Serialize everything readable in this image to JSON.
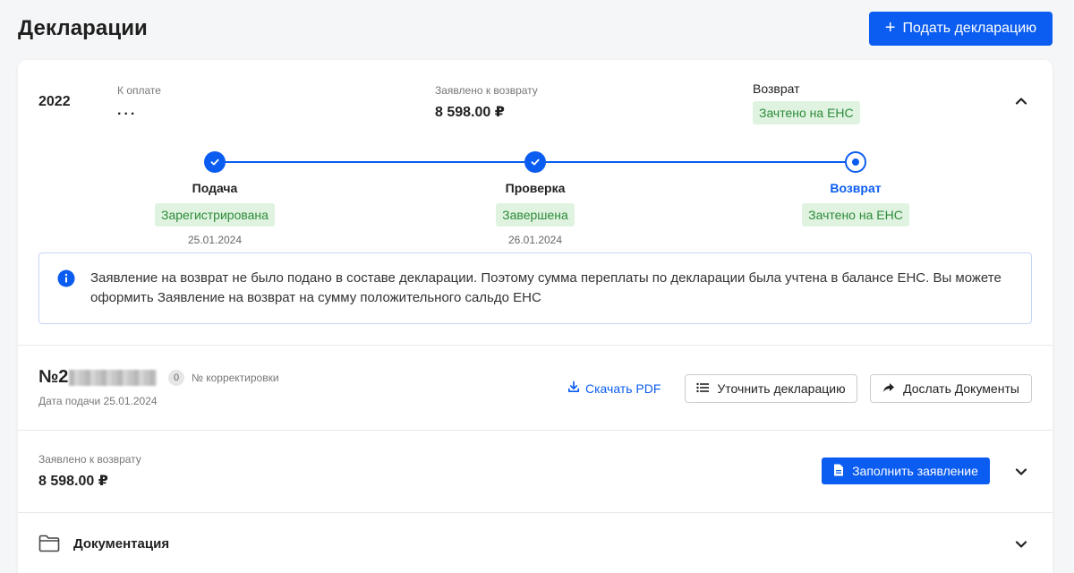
{
  "header": {
    "title": "Декларации",
    "submit_button": "Подать декларацию"
  },
  "declaration": {
    "year": "2022",
    "to_pay_label": "К оплате",
    "to_pay_value": "...",
    "claimed_refund_label": "Заявлено к возврату",
    "claimed_refund_value": "8 598.00 ₽",
    "refund_label": "Возврат",
    "refund_status": "Зачтено на ЕНС"
  },
  "steps": [
    {
      "title": "Подача",
      "status": "Зарегистрирована",
      "date": "25.01.2024",
      "state": "done"
    },
    {
      "title": "Проверка",
      "status": "Завершена",
      "date": "26.01.2024",
      "state": "done"
    },
    {
      "title": "Возврат",
      "status": "Зачтено на ЕНС",
      "date": "",
      "state": "current"
    }
  ],
  "info": {
    "text": "Заявление на возврат не было подано в составе декларации. Поэтому сумма переплаты по декларации была учтена в балансе ЕНС. Вы можете оформить Заявление на возврат на сумму положительного сальдо ЕНС"
  },
  "document": {
    "number_prefix": "№2",
    "correction_count": "0",
    "correction_label": "№ корректировки",
    "filed_date": "Дата подачи 25.01.2024",
    "download_pdf": "Скачать PDF",
    "clarify_button": "Уточнить декларацию",
    "send_docs_button": "Дослать Документы"
  },
  "claim": {
    "label": "Заявлено к возврату",
    "value": "8 598.00 ₽",
    "fill_button": "Заполнить заявление"
  },
  "documentation": {
    "title": "Документация"
  },
  "colors": {
    "accent": "#0b5cf0",
    "badge_bg": "#dff3e0",
    "badge_text": "#2e8b3a"
  }
}
